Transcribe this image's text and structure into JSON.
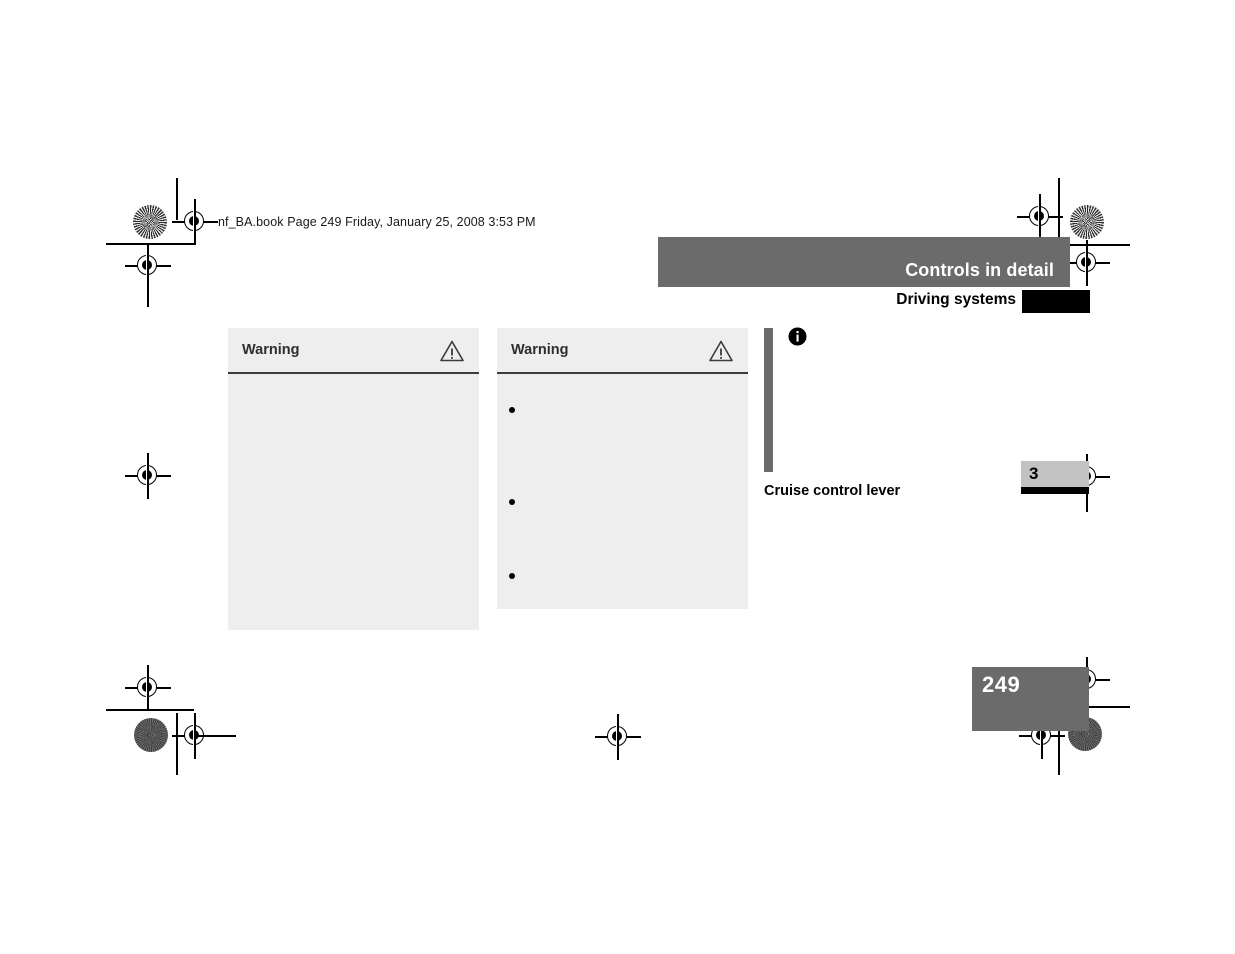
{
  "document": {
    "slug_line": "nf_BA.book  Page 249  Friday, January 25, 2008  3:53 PM",
    "page_number": "249",
    "chapter_number": "3"
  },
  "header": {
    "title": "Controls in detail",
    "subtitle": "Driving systems"
  },
  "warning_boxes": [
    {
      "title": "Warning",
      "icon": "warning-triangle-icon",
      "bullets": []
    },
    {
      "title": "Warning",
      "icon": "warning-triangle-icon",
      "bullets": [
        "",
        "",
        ""
      ]
    }
  ],
  "figure": {
    "info_icon": "info-circle-icon",
    "caption": "Cruise control lever"
  },
  "colors": {
    "header_gray": "#6b6b6b",
    "box_gray": "#eeeeee",
    "chapter_tab_gray": "#c2c2c2",
    "rule_black": "#000000",
    "text_dark": "#2e2e2e"
  }
}
